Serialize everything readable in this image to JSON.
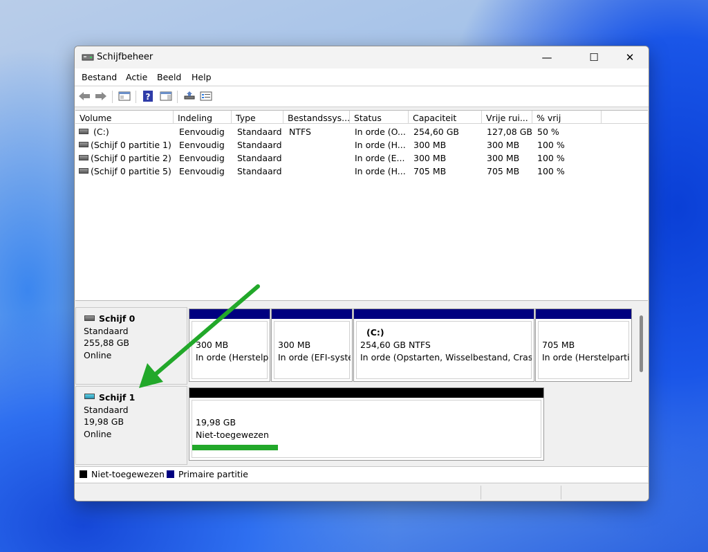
{
  "window": {
    "title": "Schijfbeheer",
    "minimize_glyph": "—",
    "maximize_glyph": "☐",
    "close_glyph": "✕"
  },
  "menu": [
    "Bestand",
    "Actie",
    "Beeld",
    "Help"
  ],
  "toolbar": [
    "back-icon",
    "forward-icon",
    "console-icon",
    "help-icon",
    "panel-icon",
    "connect-icon",
    "properties-icon"
  ],
  "volumes": {
    "columns": [
      "Volume",
      "Indeling",
      "Type",
      "Bestandssys...",
      "Status",
      "Capaciteit",
      "Vrije rui...",
      "% vrij"
    ],
    "rows": [
      [
        "(C:)",
        "Eenvoudig",
        "Standaard",
        "NTFS",
        "In orde (O...",
        "254,60 GB",
        "127,08 GB",
        "50 %"
      ],
      [
        "(Schijf 0 partitie 1)",
        "Eenvoudig",
        "Standaard",
        "",
        "In orde (H...",
        "300 MB",
        "300 MB",
        "100 %"
      ],
      [
        "(Schijf 0 partitie 2)",
        "Eenvoudig",
        "Standaard",
        "",
        "In orde (E...",
        "300 MB",
        "300 MB",
        "100 %"
      ],
      [
        "(Schijf 0 partitie 5)",
        "Eenvoudig",
        "Standaard",
        "",
        "In orde (H...",
        "705 MB",
        "705 MB",
        "100 %"
      ]
    ]
  },
  "disks": [
    {
      "name": "Schijf 0",
      "type": "Standaard",
      "size": "255,88 GB",
      "state": "Online",
      "partitions": [
        {
          "title": "",
          "size": "300 MB",
          "status": "In orde (Herstelpa"
        },
        {
          "title": "",
          "size": "300 MB",
          "status": "In orde (EFI-syste"
        },
        {
          "title": "(C:)",
          "size": "254,60 GB NTFS",
          "status": "In orde (Opstarten, Wisselbestand, Crashd"
        },
        {
          "title": "",
          "size": "705 MB",
          "status": "In orde (Herstelpartiti"
        }
      ]
    },
    {
      "name": "Schijf 1",
      "type": "Standaard",
      "size": "19,98 GB",
      "state": "Online",
      "partitions": [
        {
          "size": "19,98 GB",
          "status": "Niet-toegewezen"
        }
      ]
    }
  ],
  "legend": [
    {
      "label": "Niet-toegewezen",
      "color": "#000000"
    },
    {
      "label": "Primaire partitie",
      "color": "#000080"
    }
  ],
  "colors": {
    "primary_partition": "#000080",
    "unallocated": "#000000",
    "annotation_green": "#22a82a"
  }
}
